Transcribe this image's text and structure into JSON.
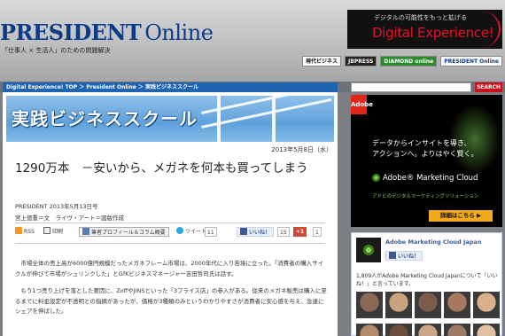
{
  "header": {
    "logo_main": "PRESIDENT",
    "logo_online": "Online",
    "tagline": "「仕事人 × 生活人」のための問題解決",
    "dx_small": "デジタルの可能性をもっと拡げる",
    "dx_title": "Digital Experience!",
    "partners": [
      "現代ビジネス",
      "JBPRESS",
      "DIAMOND online",
      "PRESIDENT Online"
    ]
  },
  "nav": {
    "breadcrumb": "Digital Experience! TOP ＞ President Online ＞ 実践ビジネススクール",
    "search_placeholder": "",
    "search_button": "SEARCH"
  },
  "article": {
    "banner_title": "実践ビジネススクール",
    "date": "2013年5月8日（水）",
    "headline": "1290万本　－安いから、メガネを何本も買ってしまう",
    "source": "PRESIDENT 2013年5月13日号",
    "byline": "宮上徳重＝文　ライヴ・アート＝図版作成",
    "toolbar": {
      "rss": "RSS",
      "print": "印刷",
      "profile": "筆者プロフィール＆コラム概要",
      "tweet": "ツイート",
      "tweet_count": "11",
      "like": "いいね！",
      "like_count": "15",
      "gplus": "+1",
      "gplus_count": "1"
    },
    "paragraphs": [
      "市場全体の売上高が6000億円規模だったメガネフレーム市場は、2000年代に入り苦境に立った。「消費者の購入サイクルが伸びて市場がシュリンクした」とGfKビジネスマネージャー吉田哲司氏は話す。",
      "もう1つ売り上げを落とした要因に、ZoffやJINSといった「3プライス店」の参入がある。従来のメガネ販売は購入に至るまでに料金設定が不透明との指摘があったが、価格が3種類のみというわかりやすさが消費者に安心感を与え、急速にシェアを伸ばした。"
    ]
  },
  "ad": {
    "logo": "Adobe",
    "copy_line1": "データからインサイトを導き、",
    "copy_line2": "アクションへ。よりはやく賢く。",
    "brand": "Adobe® Marketing Cloud",
    "sub": "アドビのデジタルマーケティングソリューション",
    "button": "詳細はこちら ▶"
  },
  "facebook": {
    "page_name": "Adobe Marketing Cloud Japan",
    "like_button": "いいね！",
    "count_text": "1,809人がAdobe Marketing Cloud Japanについて「いいね！」と言っています。",
    "face_colors": [
      "#8a6a55",
      "#c9a27f",
      "#7b5b4a",
      "#a7785f",
      "#d8b08e",
      "#b48a6c",
      "#6b4e3d",
      "#caa487",
      "#9c7a63",
      "#e0c0a2"
    ]
  }
}
